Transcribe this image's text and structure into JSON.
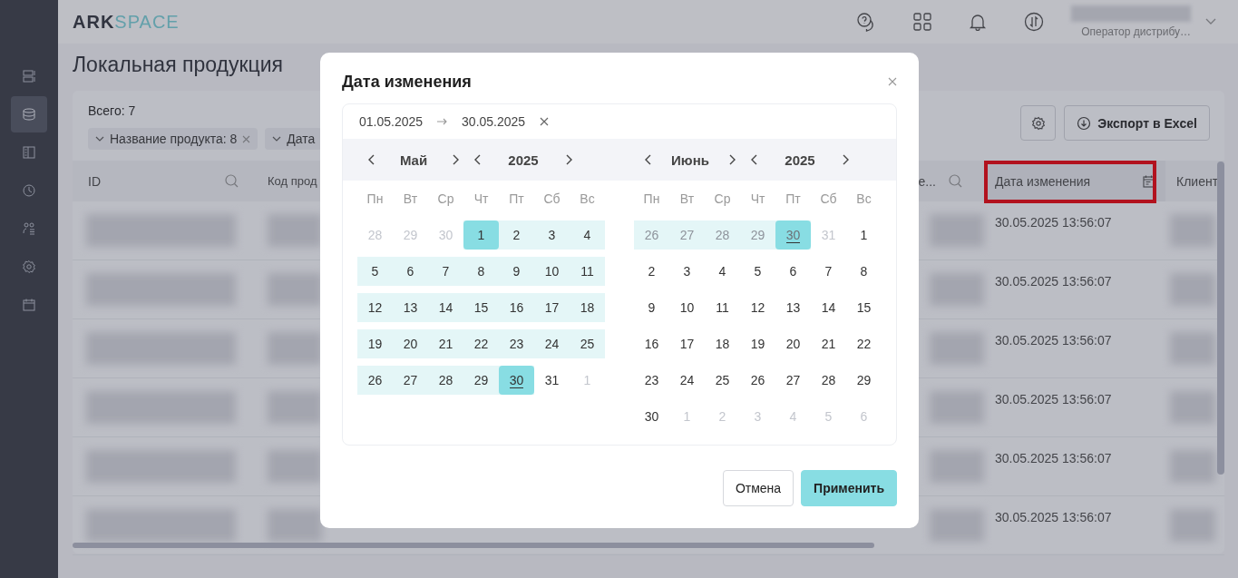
{
  "logo": {
    "strong": "ARK",
    "light": "SPACE"
  },
  "header": {
    "user_role": "Оператор дистрибу…"
  },
  "sidebar": {
    "items": [
      {
        "selected": false
      },
      {
        "selected": true
      },
      {
        "selected": false
      },
      {
        "selected": false
      },
      {
        "selected": false
      },
      {
        "selected": false
      },
      {
        "selected": false
      }
    ]
  },
  "page_title": "Локальная продукция",
  "total": "Всего: 7",
  "filters": [
    {
      "label": "Название продукта: 8",
      "removable": true
    },
    {
      "label": "Дата",
      "removable": false
    }
  ],
  "export_button": "Экспорт в Excel",
  "table": {
    "columns": [
      {
        "label": "ID",
        "highlighted": false
      },
      {
        "label": "Код прод",
        "highlighted": false
      },
      {
        "label": "е...",
        "highlighted": false
      },
      {
        "label": "Дата изменения",
        "highlighted": true
      },
      {
        "label": "Клиент",
        "highlighted": false
      }
    ],
    "rows": [
      {
        "modified": "30.05.2025 13:56:07"
      },
      {
        "modified": "30.05.2025 13:56:07"
      },
      {
        "modified": "30.05.2025 13:56:07"
      },
      {
        "modified": "30.05.2025 13:56:07"
      },
      {
        "modified": "30.05.2025 13:56:07"
      },
      {
        "modified": "30.05.2025 13:56:07"
      }
    ]
  },
  "dialog": {
    "title": "Дата изменения",
    "start": "01.05.2025",
    "end": "30.05.2025",
    "months": [
      {
        "month": "Май",
        "year": "2025",
        "weekdays": [
          "Пн",
          "Вт",
          "Ср",
          "Чт",
          "Пт",
          "Сб",
          "Вс"
        ],
        "weeks": [
          [
            {
              "day": "28",
              "other_month": true,
              "in_range": false,
              "selected": false,
              "today": false
            },
            {
              "day": "29",
              "other_month": true,
              "in_range": false,
              "selected": false,
              "today": false
            },
            {
              "day": "30",
              "other_month": true,
              "in_range": false,
              "selected": false,
              "today": false
            },
            {
              "day": "1",
              "other_month": false,
              "in_range": true,
              "selected": true,
              "today": false
            },
            {
              "day": "2",
              "other_month": false,
              "in_range": true,
              "selected": false,
              "today": false
            },
            {
              "day": "3",
              "other_month": false,
              "in_range": true,
              "selected": false,
              "today": false
            },
            {
              "day": "4",
              "other_month": false,
              "in_range": true,
              "selected": false,
              "today": false
            }
          ],
          [
            {
              "day": "5",
              "other_month": false,
              "in_range": true,
              "selected": false,
              "today": false
            },
            {
              "day": "6",
              "other_month": false,
              "in_range": true,
              "selected": false,
              "today": false
            },
            {
              "day": "7",
              "other_month": false,
              "in_range": true,
              "selected": false,
              "today": false
            },
            {
              "day": "8",
              "other_month": false,
              "in_range": true,
              "selected": false,
              "today": false
            },
            {
              "day": "9",
              "other_month": false,
              "in_range": true,
              "selected": false,
              "today": false
            },
            {
              "day": "10",
              "other_month": false,
              "in_range": true,
              "selected": false,
              "today": false
            },
            {
              "day": "11",
              "other_month": false,
              "in_range": true,
              "selected": false,
              "today": false
            }
          ],
          [
            {
              "day": "12",
              "other_month": false,
              "in_range": true,
              "selected": false,
              "today": false
            },
            {
              "day": "13",
              "other_month": false,
              "in_range": true,
              "selected": false,
              "today": false
            },
            {
              "day": "14",
              "other_month": false,
              "in_range": true,
              "selected": false,
              "today": false
            },
            {
              "day": "15",
              "other_month": false,
              "in_range": true,
              "selected": false,
              "today": false
            },
            {
              "day": "16",
              "other_month": false,
              "in_range": true,
              "selected": false,
              "today": false
            },
            {
              "day": "17",
              "other_month": false,
              "in_range": true,
              "selected": false,
              "today": false
            },
            {
              "day": "18",
              "other_month": false,
              "in_range": true,
              "selected": false,
              "today": false
            }
          ],
          [
            {
              "day": "19",
              "other_month": false,
              "in_range": true,
              "selected": false,
              "today": false
            },
            {
              "day": "20",
              "other_month": false,
              "in_range": true,
              "selected": false,
              "today": false
            },
            {
              "day": "21",
              "other_month": false,
              "in_range": true,
              "selected": false,
              "today": false
            },
            {
              "day": "22",
              "other_month": false,
              "in_range": true,
              "selected": false,
              "today": false
            },
            {
              "day": "23",
              "other_month": false,
              "in_range": true,
              "selected": false,
              "today": false
            },
            {
              "day": "24",
              "other_month": false,
              "in_range": true,
              "selected": false,
              "today": false
            },
            {
              "day": "25",
              "other_month": false,
              "in_range": true,
              "selected": false,
              "today": false
            }
          ],
          [
            {
              "day": "26",
              "other_month": false,
              "in_range": true,
              "selected": false,
              "today": false
            },
            {
              "day": "27",
              "other_month": false,
              "in_range": true,
              "selected": false,
              "today": false
            },
            {
              "day": "28",
              "other_month": false,
              "in_range": true,
              "selected": false,
              "today": false
            },
            {
              "day": "29",
              "other_month": false,
              "in_range": true,
              "selected": false,
              "today": false
            },
            {
              "day": "30",
              "other_month": false,
              "in_range": true,
              "selected": true,
              "today": true
            },
            {
              "day": "31",
              "other_month": false,
              "in_range": false,
              "selected": false,
              "today": false
            },
            {
              "day": "1",
              "other_month": true,
              "in_range": false,
              "selected": false,
              "today": false
            }
          ]
        ]
      },
      {
        "month": "Июнь",
        "year": "2025",
        "weekdays": [
          "Пн",
          "Вт",
          "Ср",
          "Чт",
          "Пт",
          "Сб",
          "Вс"
        ],
        "weeks": [
          [
            {
              "day": "26",
              "other_month": true,
              "in_range": true,
              "selected": false,
              "today": false
            },
            {
              "day": "27",
              "other_month": true,
              "in_range": true,
              "selected": false,
              "today": false
            },
            {
              "day": "28",
              "other_month": true,
              "in_range": true,
              "selected": false,
              "today": false
            },
            {
              "day": "29",
              "other_month": true,
              "in_range": true,
              "selected": false,
              "today": false
            },
            {
              "day": "30",
              "other_month": true,
              "in_range": true,
              "selected": true,
              "today": true
            },
            {
              "day": "31",
              "other_month": true,
              "in_range": false,
              "selected": false,
              "today": false
            },
            {
              "day": "1",
              "other_month": false,
              "in_range": false,
              "selected": false,
              "today": false
            }
          ],
          [
            {
              "day": "2",
              "other_month": false,
              "in_range": false,
              "selected": false,
              "today": false
            },
            {
              "day": "3",
              "other_month": false,
              "in_range": false,
              "selected": false,
              "today": false
            },
            {
              "day": "4",
              "other_month": false,
              "in_range": false,
              "selected": false,
              "today": false
            },
            {
              "day": "5",
              "other_month": false,
              "in_range": false,
              "selected": false,
              "today": false
            },
            {
              "day": "6",
              "other_month": false,
              "in_range": false,
              "selected": false,
              "today": false
            },
            {
              "day": "7",
              "other_month": false,
              "in_range": false,
              "selected": false,
              "today": false
            },
            {
              "day": "8",
              "other_month": false,
              "in_range": false,
              "selected": false,
              "today": false
            }
          ],
          [
            {
              "day": "9",
              "other_month": false,
              "in_range": false,
              "selected": false,
              "today": false
            },
            {
              "day": "10",
              "other_month": false,
              "in_range": false,
              "selected": false,
              "today": false
            },
            {
              "day": "11",
              "other_month": false,
              "in_range": false,
              "selected": false,
              "today": false
            },
            {
              "day": "12",
              "other_month": false,
              "in_range": false,
              "selected": false,
              "today": false
            },
            {
              "day": "13",
              "other_month": false,
              "in_range": false,
              "selected": false,
              "today": false
            },
            {
              "day": "14",
              "other_month": false,
              "in_range": false,
              "selected": false,
              "today": false
            },
            {
              "day": "15",
              "other_month": false,
              "in_range": false,
              "selected": false,
              "today": false
            }
          ],
          [
            {
              "day": "16",
              "other_month": false,
              "in_range": false,
              "selected": false,
              "today": false
            },
            {
              "day": "17",
              "other_month": false,
              "in_range": false,
              "selected": false,
              "today": false
            },
            {
              "day": "18",
              "other_month": false,
              "in_range": false,
              "selected": false,
              "today": false
            },
            {
              "day": "19",
              "other_month": false,
              "in_range": false,
              "selected": false,
              "today": false
            },
            {
              "day": "20",
              "other_month": false,
              "in_range": false,
              "selected": false,
              "today": false
            },
            {
              "day": "21",
              "other_month": false,
              "in_range": false,
              "selected": false,
              "today": false
            },
            {
              "day": "22",
              "other_month": false,
              "in_range": false,
              "selected": false,
              "today": false
            }
          ],
          [
            {
              "day": "23",
              "other_month": false,
              "in_range": false,
              "selected": false,
              "today": false
            },
            {
              "day": "24",
              "other_month": false,
              "in_range": false,
              "selected": false,
              "today": false
            },
            {
              "day": "25",
              "other_month": false,
              "in_range": false,
              "selected": false,
              "today": false
            },
            {
              "day": "26",
              "other_month": false,
              "in_range": false,
              "selected": false,
              "today": false
            },
            {
              "day": "27",
              "other_month": false,
              "in_range": false,
              "selected": false,
              "today": false
            },
            {
              "day": "28",
              "other_month": false,
              "in_range": false,
              "selected": false,
              "today": false
            },
            {
              "day": "29",
              "other_month": false,
              "in_range": false,
              "selected": false,
              "today": false
            }
          ],
          [
            {
              "day": "30",
              "other_month": false,
              "in_range": false,
              "selected": false,
              "today": false
            },
            {
              "day": "1",
              "other_month": true,
              "in_range": false,
              "selected": false,
              "today": false
            },
            {
              "day": "2",
              "other_month": true,
              "in_range": false,
              "selected": false,
              "today": false
            },
            {
              "day": "3",
              "other_month": true,
              "in_range": false,
              "selected": false,
              "today": false
            },
            {
              "day": "4",
              "other_month": true,
              "in_range": false,
              "selected": false,
              "today": false
            },
            {
              "day": "5",
              "other_month": true,
              "in_range": false,
              "selected": false,
              "today": false
            },
            {
              "day": "6",
              "other_month": true,
              "in_range": false,
              "selected": false,
              "today": false
            }
          ]
        ]
      }
    ],
    "buttons": [
      {
        "label": "Отмена",
        "kind": "secondary"
      },
      {
        "label": "Применить",
        "kind": "primary"
      }
    ]
  }
}
